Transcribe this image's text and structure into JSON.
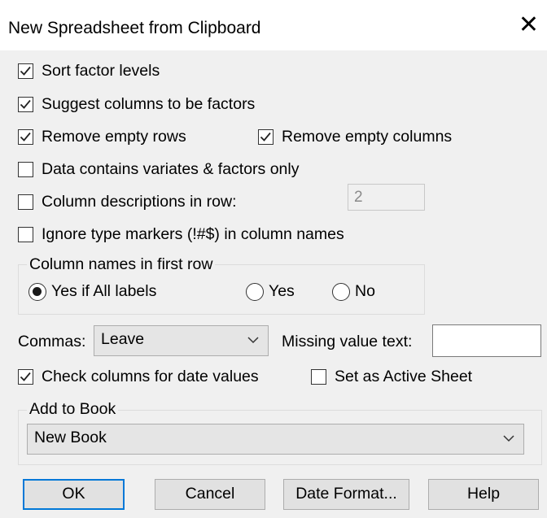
{
  "dialog": {
    "title": "New Spreadsheet from Clipboard",
    "close_glyph": "✕"
  },
  "options": {
    "sort_factor_levels": {
      "label": "Sort factor levels",
      "checked": true
    },
    "suggest_factors": {
      "label": "Suggest columns to be factors",
      "checked": true
    },
    "remove_empty_rows": {
      "label": "Remove empty rows",
      "checked": true
    },
    "remove_empty_columns": {
      "label": "Remove empty columns",
      "checked": true
    },
    "variates_factors_only": {
      "label": "Data contains variates & factors only",
      "checked": false
    },
    "column_descriptions": {
      "label": "Column descriptions in row:",
      "checked": false,
      "row_value": "2"
    },
    "ignore_type_markers": {
      "label": "Ignore type markers (!#$) in column names",
      "checked": false
    }
  },
  "column_names_group": {
    "title": "Column names in first row",
    "options": [
      {
        "label": "Yes if All labels",
        "selected": true
      },
      {
        "label": "Yes",
        "selected": false
      },
      {
        "label": "No",
        "selected": false
      }
    ]
  },
  "commas": {
    "label": "Commas:",
    "value": "Leave"
  },
  "missing_value": {
    "label": "Missing value text:",
    "value": ""
  },
  "check_dates": {
    "label": "Check columns for date values",
    "checked": true
  },
  "set_active": {
    "label": "Set as Active Sheet",
    "checked": false
  },
  "add_to_book": {
    "title": "Add to Book",
    "value": "New Book"
  },
  "buttons": {
    "ok": "OK",
    "cancel": "Cancel",
    "date_format": "Date Format...",
    "help": "Help"
  }
}
